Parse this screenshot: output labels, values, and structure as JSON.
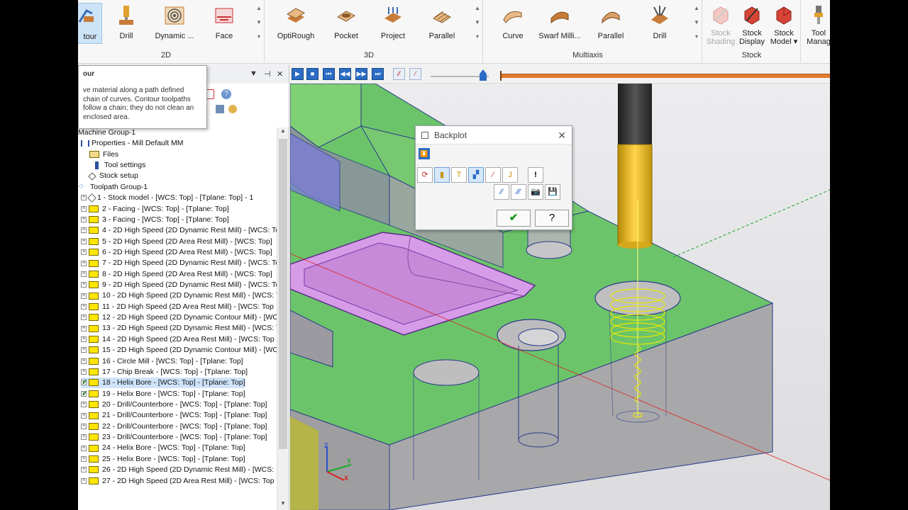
{
  "ribbon": {
    "groups": [
      {
        "label": "2D",
        "items": [
          "tour",
          "Drill",
          "Dynamic ...",
          "Face"
        ]
      },
      {
        "label": "3D",
        "items": [
          "OptiRough",
          "Pocket",
          "Project",
          "Parallel"
        ]
      },
      {
        "label": "Multiaxis",
        "items": [
          "Curve",
          "Swarf Milli...",
          "Parallel",
          "Drill"
        ]
      },
      {
        "label": "Stock",
        "items": [
          "Stock Shading",
          "Stock Display",
          "Stock Model"
        ]
      },
      {
        "label": "",
        "items": [
          "Tool Manag"
        ]
      }
    ],
    "stock_shading_line1": "Stock",
    "stock_shading_line2": "Shading",
    "stock_display_line1": "Stock",
    "stock_display_line2": "Display",
    "stock_model_line1": "Stock",
    "stock_model_line2": "Model",
    "tool_manag_line1": "Tool",
    "tool_manag_line2": "Manag"
  },
  "tooltip": {
    "title": "our",
    "body": "ve material along a path defined chain of curves. Contour toolpaths follow a chain; they do not clean an enclosed area."
  },
  "tree": {
    "items": [
      {
        "label": "Machine Group-1",
        "type": "group"
      },
      {
        "label": "Properties - Mill Default MM",
        "type": "props"
      },
      {
        "label": "Files",
        "type": "files"
      },
      {
        "label": "Tool settings",
        "type": "tool"
      },
      {
        "label": "Stock setup",
        "type": "stock"
      },
      {
        "label": "Toolpath Group-1",
        "type": "tpgroup"
      },
      {
        "label": "1 - Stock model - [WCS: Top] - [Tplane: Top] - 1",
        "type": "stockmodel"
      },
      {
        "label": "2 - Facing - [WCS: Top] - [Tplane: Top]",
        "type": "op"
      },
      {
        "label": "3 - Facing - [WCS: Top] - [Tplane: Top]",
        "type": "op"
      },
      {
        "label": "4 - 2D High Speed (2D Dynamic Rest Mill) - [WCS: To",
        "type": "op"
      },
      {
        "label": "5 - 2D High Speed (2D Area Rest Mill) - [WCS: Top]",
        "type": "op"
      },
      {
        "label": "6 - 2D High Speed (2D Area Rest Mill) - [WCS: Top]",
        "type": "op"
      },
      {
        "label": "7 - 2D High Speed (2D Dynamic Rest Mill) - [WCS: To",
        "type": "op"
      },
      {
        "label": "8 - 2D High Speed (2D Area Rest Mill) - [WCS: Top]",
        "type": "op"
      },
      {
        "label": "9 - 2D High Speed (2D Dynamic Rest Mill) - [WCS: To",
        "type": "op"
      },
      {
        "label": "10 - 2D High Speed (2D Dynamic Rest Mill) - [WCS: T",
        "type": "op"
      },
      {
        "label": "11 - 2D High Speed (2D Area Rest Mill) - [WCS: Top",
        "type": "op"
      },
      {
        "label": "12 - 2D High Speed (2D Dynamic Contour Mill) - [WC",
        "type": "op"
      },
      {
        "label": "13 - 2D High Speed (2D Dynamic Rest Mill) - [WCS: T",
        "type": "op"
      },
      {
        "label": "14 - 2D High Speed (2D Area Rest Mill) - [WCS: Top",
        "type": "op"
      },
      {
        "label": "15 - 2D High Speed (2D Dynamic Contour Mill) - [WC",
        "type": "op"
      },
      {
        "label": "16 - Circle Mill - [WCS: Top] - [Tplane: Top]",
        "type": "op"
      },
      {
        "label": "17 - Chip Break - [WCS: Top] - [Tplane: Top]",
        "type": "op"
      },
      {
        "label": "18 - Helix Bore - [WCS: Top] - [Tplane: Top]",
        "type": "op",
        "selected": true,
        "checked": true
      },
      {
        "label": "19 - Helix Bore - [WCS: Top] - [Tplane: Top]",
        "type": "op",
        "checked": true
      },
      {
        "label": "20 - Drill/Counterbore - [WCS: Top] - [Tplane: Top]",
        "type": "op"
      },
      {
        "label": "21 - Drill/Counterbore - [WCS: Top] - [Tplane: Top]",
        "type": "op"
      },
      {
        "label": "22 - Drill/Counterbore - [WCS: Top] - [Tplane: Top]",
        "type": "op"
      },
      {
        "label": "23 - Drill/Counterbore - [WCS: Top] - [Tplane: Top]",
        "type": "op"
      },
      {
        "label": "24 - Helix Bore - [WCS: Top] - [Tplane: Top]",
        "type": "op"
      },
      {
        "label": "25 - Helix Bore - [WCS: Top] - [Tplane: Top]",
        "type": "op"
      },
      {
        "label": "26 - 2D High Speed (2D Dynamic Rest Mill) - [WCS: ",
        "type": "op"
      },
      {
        "label": "27 - 2D High Speed (2D Area Rest Mill) - [WCS: Top",
        "type": "op"
      }
    ]
  },
  "backplot": {
    "title": "Backplot"
  },
  "triad": {
    "x": "X",
    "y": "Y",
    "z": "Z"
  },
  "colors": {
    "accent": "#2b6cc4",
    "part_top": "#6cc46a",
    "part_side": "#a9a9a9",
    "pocket": "#d79ce8",
    "tool_holder": "#e7b81d",
    "toolpath": "#e8e800",
    "timeline": "#e07a2e"
  }
}
